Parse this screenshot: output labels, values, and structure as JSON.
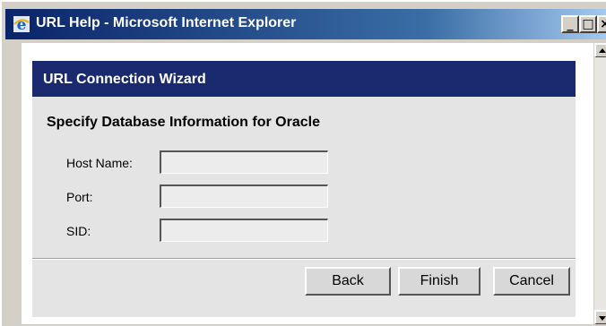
{
  "window": {
    "title": "URL Help - Microsoft Internet Explorer",
    "minimize_glyph": "_",
    "maximize_glyph": "□",
    "close_glyph": "×"
  },
  "wizard": {
    "header_title": "URL Connection Wizard",
    "section_title": "Specify Database Information for Oracle",
    "fields": [
      {
        "label": "Host Name:",
        "value": ""
      },
      {
        "label": "Port:",
        "value": ""
      },
      {
        "label": "SID:",
        "value": ""
      }
    ],
    "buttons": {
      "back": "Back",
      "finish": "Finish",
      "cancel": "Cancel"
    }
  },
  "icons": {
    "app_icon": "internet-explorer-icon",
    "scroll_up": "scroll-up-arrow-icon",
    "scroll_down": "scroll-down-arrow-icon"
  },
  "colors": {
    "titlebar_start": "#0a246a",
    "wizard_header": "#1a2a6e",
    "wizard_body": "#e4e4e4"
  }
}
